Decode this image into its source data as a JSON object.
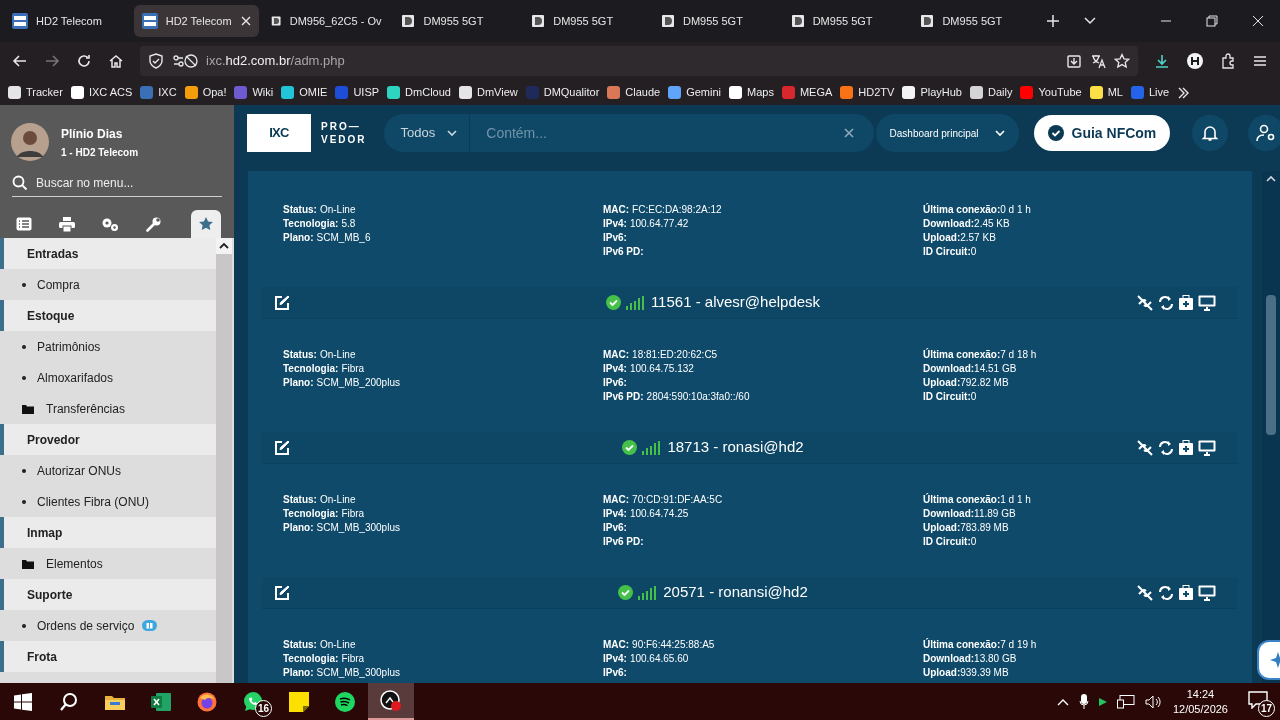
{
  "browser": {
    "tabs": [
      {
        "label": "HD2 Telecom",
        "selected": false
      },
      {
        "label": "HD2 Telecom",
        "selected": true
      },
      {
        "label": "DM956_62C5 - Ov",
        "selected": false
      },
      {
        "label": "DM955 5GT",
        "selected": false
      },
      {
        "label": "DM955 5GT",
        "selected": false
      },
      {
        "label": "DM955 5GT",
        "selected": false
      },
      {
        "label": "DM955 5GT",
        "selected": false
      },
      {
        "label": "DM955 5GT",
        "selected": false
      }
    ],
    "url_prefix": "ixc.",
    "url_host": "hd2.com.br",
    "url_path": "/adm.php",
    "bookmarks": [
      {
        "label": "Tracker",
        "color": "#e5e5e5"
      },
      {
        "label": "IXC ACS",
        "color": "#ffffff"
      },
      {
        "label": "IXC",
        "color": "#3b6fb6"
      },
      {
        "label": "Opa!",
        "color": "#f59e0b"
      },
      {
        "label": "Wiki",
        "color": "#6d5bd0"
      },
      {
        "label": "OMIE",
        "color": "#22c5d8"
      },
      {
        "label": "UISP",
        "color": "#1d4ed8"
      },
      {
        "label": "DmCloud",
        "color": "#2dd4bf"
      },
      {
        "label": "DmView",
        "color": "#e5e5e5"
      },
      {
        "label": "DMQualitor",
        "color": "#1e2a5a"
      },
      {
        "label": "Claude",
        "color": "#d97757"
      },
      {
        "label": "Gemini",
        "color": "#60a5fa"
      },
      {
        "label": "Maps",
        "color": "#ffffff"
      },
      {
        "label": "MEGA",
        "color": "#d9272e"
      },
      {
        "label": "HD2TV",
        "color": "#f97316"
      },
      {
        "label": "PlayHub",
        "color": "#f3f4f6"
      },
      {
        "label": "Daily",
        "color": "#d4d4d4"
      },
      {
        "label": "YouTube",
        "color": "#ff0000"
      },
      {
        "label": "ML",
        "color": "#fde047"
      },
      {
        "label": "Live",
        "color": "#2563eb"
      }
    ]
  },
  "sidebar": {
    "user_name": "Plínio Dias",
    "user_company": "1 - HD2 Telecom",
    "search_placeholder": "Buscar no menu...",
    "tabs": [
      {
        "selected": false
      },
      {
        "selected": false
      },
      {
        "selected": false
      },
      {
        "selected": false
      },
      {
        "selected": true
      }
    ],
    "items": [
      {
        "kind": "header",
        "label": "Entradas"
      },
      {
        "kind": "link",
        "label": "Compra"
      },
      {
        "kind": "header",
        "label": "Estoque"
      },
      {
        "kind": "link",
        "label": "Patrimônios"
      },
      {
        "kind": "link",
        "label": "Almoxarifados"
      },
      {
        "kind": "folder",
        "label": "Transferências"
      },
      {
        "kind": "header",
        "label": "Provedor"
      },
      {
        "kind": "link",
        "label": "Autorizar ONUs"
      },
      {
        "kind": "link",
        "label": "Clientes Fibra (ONU)"
      },
      {
        "kind": "header",
        "label": "Inmap"
      },
      {
        "kind": "folder",
        "label": "Elementos"
      },
      {
        "kind": "header",
        "label": "Suporte"
      },
      {
        "kind": "link",
        "label": "Ordens de serviço",
        "gift": true
      },
      {
        "kind": "header",
        "label": "Frota"
      }
    ]
  },
  "topbar": {
    "logo_mark": "IXC",
    "logo_line1": "PRO—",
    "logo_line2": "VEDOR",
    "filter": "Todos",
    "search_placeholder": "Contém...",
    "dashboard": "Dashboard principal",
    "nfcom_button": "Guia NFCom"
  },
  "logins": [
    {
      "columns": [
        [
          {
            "label": "Status:",
            "value": "On-Line"
          },
          {
            "label": "Tecnologia:",
            "value": "5.8"
          },
          {
            "label": "Plano:",
            "value": "SCM_MB_6"
          }
        ],
        [
          {
            "label": "MAC:",
            "value": "FC:EC:DA:98:2A:12"
          },
          {
            "label": "IPv4:",
            "value": "100.64.77.42"
          },
          {
            "label": "IPv6:"
          },
          {
            "label": "IPv6 PD:"
          }
        ],
        [
          {
            "label": "Última conexão:",
            "value": "0 d 1 h"
          },
          {
            "label": "Download:",
            "value": "2.45 KB"
          },
          {
            "label": "Upload:",
            "value": "2.57 KB"
          },
          {
            "label": "ID Circuit:",
            "value": "0"
          }
        ]
      ]
    },
    {
      "title": "11561 - alvesr@helpdesk",
      "online": true,
      "columns": [
        [
          {
            "label": "Status:",
            "value": "On-Line"
          },
          {
            "label": "Tecnologia:",
            "value": "Fibra"
          },
          {
            "label": "Plano:",
            "value": "SCM_MB_200plus"
          }
        ],
        [
          {
            "label": "MAC:",
            "value": "18:81:ED:20:62:C5"
          },
          {
            "label": "IPv4:",
            "value": "100.64.75.132"
          },
          {
            "label": "IPv6:"
          },
          {
            "label": "IPv6 PD:",
            "value": "2804:590:10a:3fa0::/60"
          }
        ],
        [
          {
            "label": "Última conexão:",
            "value": "7 d 18 h"
          },
          {
            "label": "Download:",
            "value": "14.51 GB"
          },
          {
            "label": "Upload:",
            "value": "792.82 MB"
          },
          {
            "label": "ID Circuit:",
            "value": "0"
          }
        ]
      ]
    },
    {
      "title": "18713 - ronasi@hd2",
      "online": true,
      "columns": [
        [
          {
            "label": "Status:",
            "value": "On-Line"
          },
          {
            "label": "Tecnologia:",
            "value": "Fibra"
          },
          {
            "label": "Plano:",
            "value": "SCM_MB_300plus"
          }
        ],
        [
          {
            "label": "MAC:",
            "value": "70:CD:91:DF:AA:5C"
          },
          {
            "label": "IPv4:",
            "value": "100.64.74.25"
          },
          {
            "label": "IPv6:"
          },
          {
            "label": "IPv6 PD:"
          }
        ],
        [
          {
            "label": "Última conexão:",
            "value": "1 d 1 h"
          },
          {
            "label": "Download:",
            "value": "11.89 GB"
          },
          {
            "label": "Upload:",
            "value": "783.89 MB"
          },
          {
            "label": "ID Circuit:",
            "value": "0"
          }
        ]
      ]
    },
    {
      "title": "20571 - ronansi@hd2",
      "online": true,
      "columns": [
        [
          {
            "label": "Status:",
            "value": "On-Line"
          },
          {
            "label": "Tecnologia:",
            "value": "Fibra"
          },
          {
            "label": "Plano:",
            "value": "SCM_MB_300plus"
          }
        ],
        [
          {
            "label": "MAC:",
            "value": "90:F6:44:25:88:A5"
          },
          {
            "label": "IPv4:",
            "value": "100.64.65.60"
          },
          {
            "label": "IPv6:"
          }
        ],
        [
          {
            "label": "Última conexão:",
            "value": "7 d 19 h"
          },
          {
            "label": "Download:",
            "value": "13.80 GB"
          },
          {
            "label": "Upload:",
            "value": "939.39 MB"
          }
        ]
      ]
    }
  ],
  "taskbar": {
    "apps": [
      {
        "selected": false
      },
      {
        "selected": false
      },
      {
        "selected": false
      },
      {
        "selected": false,
        "badge": "16"
      },
      {
        "selected": false
      },
      {
        "selected": false
      },
      {
        "selected": true
      }
    ],
    "time": "14:24",
    "date": "12/05/2026",
    "notifications": "17"
  }
}
